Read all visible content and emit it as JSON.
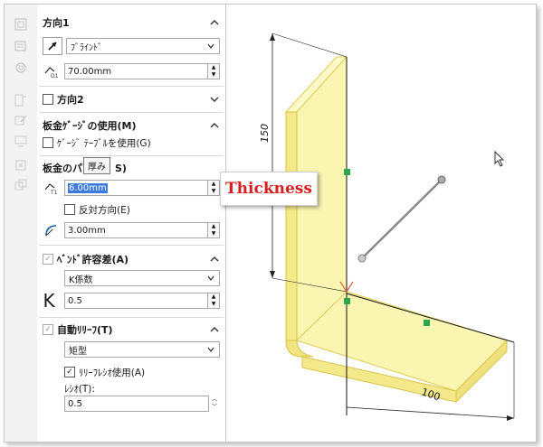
{
  "panel": {
    "dir1": {
      "title": "方向1",
      "end_condition": "ﾌﾞﾗｲﾝﾄﾞ",
      "depth": "70.00mm"
    },
    "dir2": {
      "title": "方向2"
    },
    "gauge": {
      "title": "板金ｹﾞｰｼﾞの使用(M)",
      "use_table": "ｹﾞｰｼﾞ ﾃｰﾌﾞﾙを使用(G)"
    },
    "params": {
      "title_prefix": "板金のパ",
      "title_suffix": "S)",
      "thickness": "6.00mm",
      "reverse": "反対方向(E)",
      "radius": "3.00mm"
    },
    "tooltip": "厚み",
    "bend_allowance": {
      "title": "ﾍﾞﾝﾄﾞ許容差(A)",
      "type": "K係数",
      "k_symbol": "K",
      "k_value": "0.5"
    },
    "relief": {
      "title": "自動ﾘﾘｰﾌ(T)",
      "type": "矩型",
      "use_ratio": "ﾘﾘｰﾌﾚｼｵ使用(A)",
      "ratio_label": "ﾚｼｵ(T):",
      "ratio_value": "0.5"
    }
  },
  "callout": "Thickness",
  "model": {
    "dim_height": "150",
    "dim_width": "100"
  },
  "colors": {
    "part_face": "#fbf6b8",
    "part_edge": "#e7d45a",
    "accent_red": "#d42020",
    "highlight": "#3d7be0"
  }
}
